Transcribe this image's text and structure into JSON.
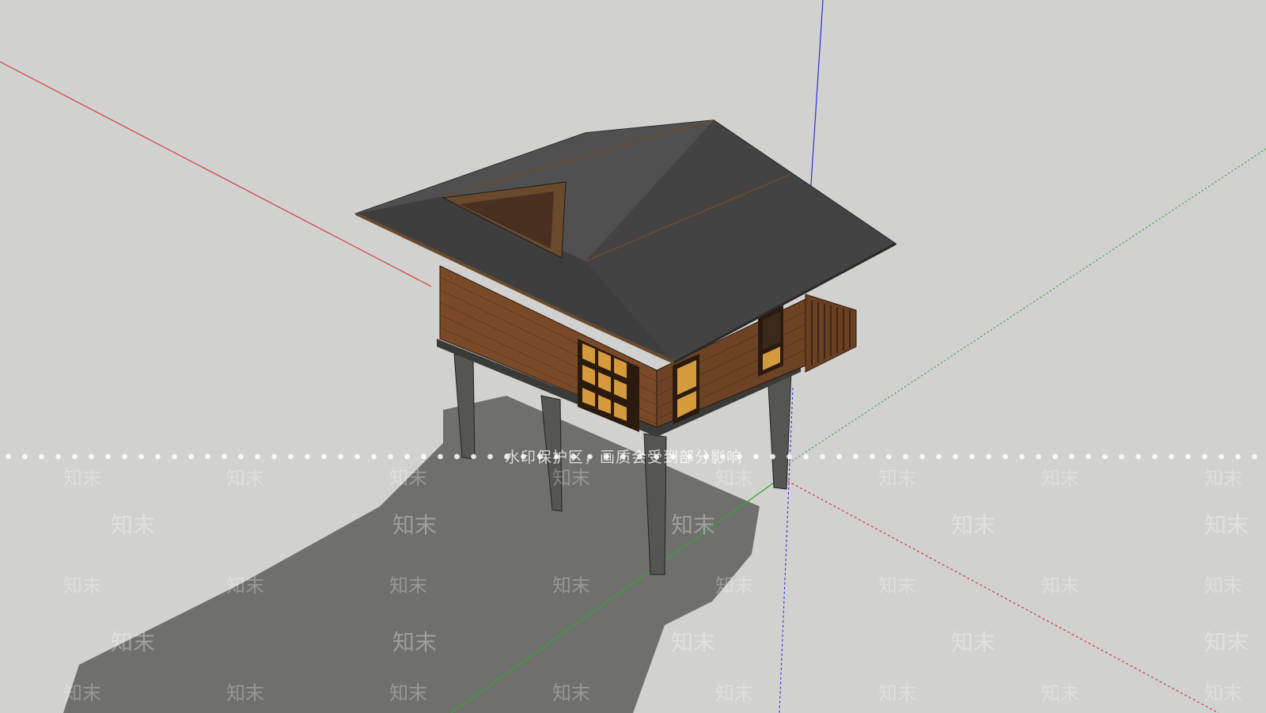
{
  "viewport": {
    "background": "#d1d1cf",
    "axes": {
      "red": "#d23c3c",
      "green": "#35a535",
      "blue": "#2f2fd8"
    }
  },
  "model": {
    "roof_color": "#4a4a4a",
    "wall_color": "#7a4a28",
    "post_color": "#4f4f4c",
    "window_color": "#d49a3c",
    "shadow_color": "#6f6f6d"
  },
  "watermark": {
    "notice": "水印保护区，画质会受到部分影响",
    "brand": "知末"
  }
}
